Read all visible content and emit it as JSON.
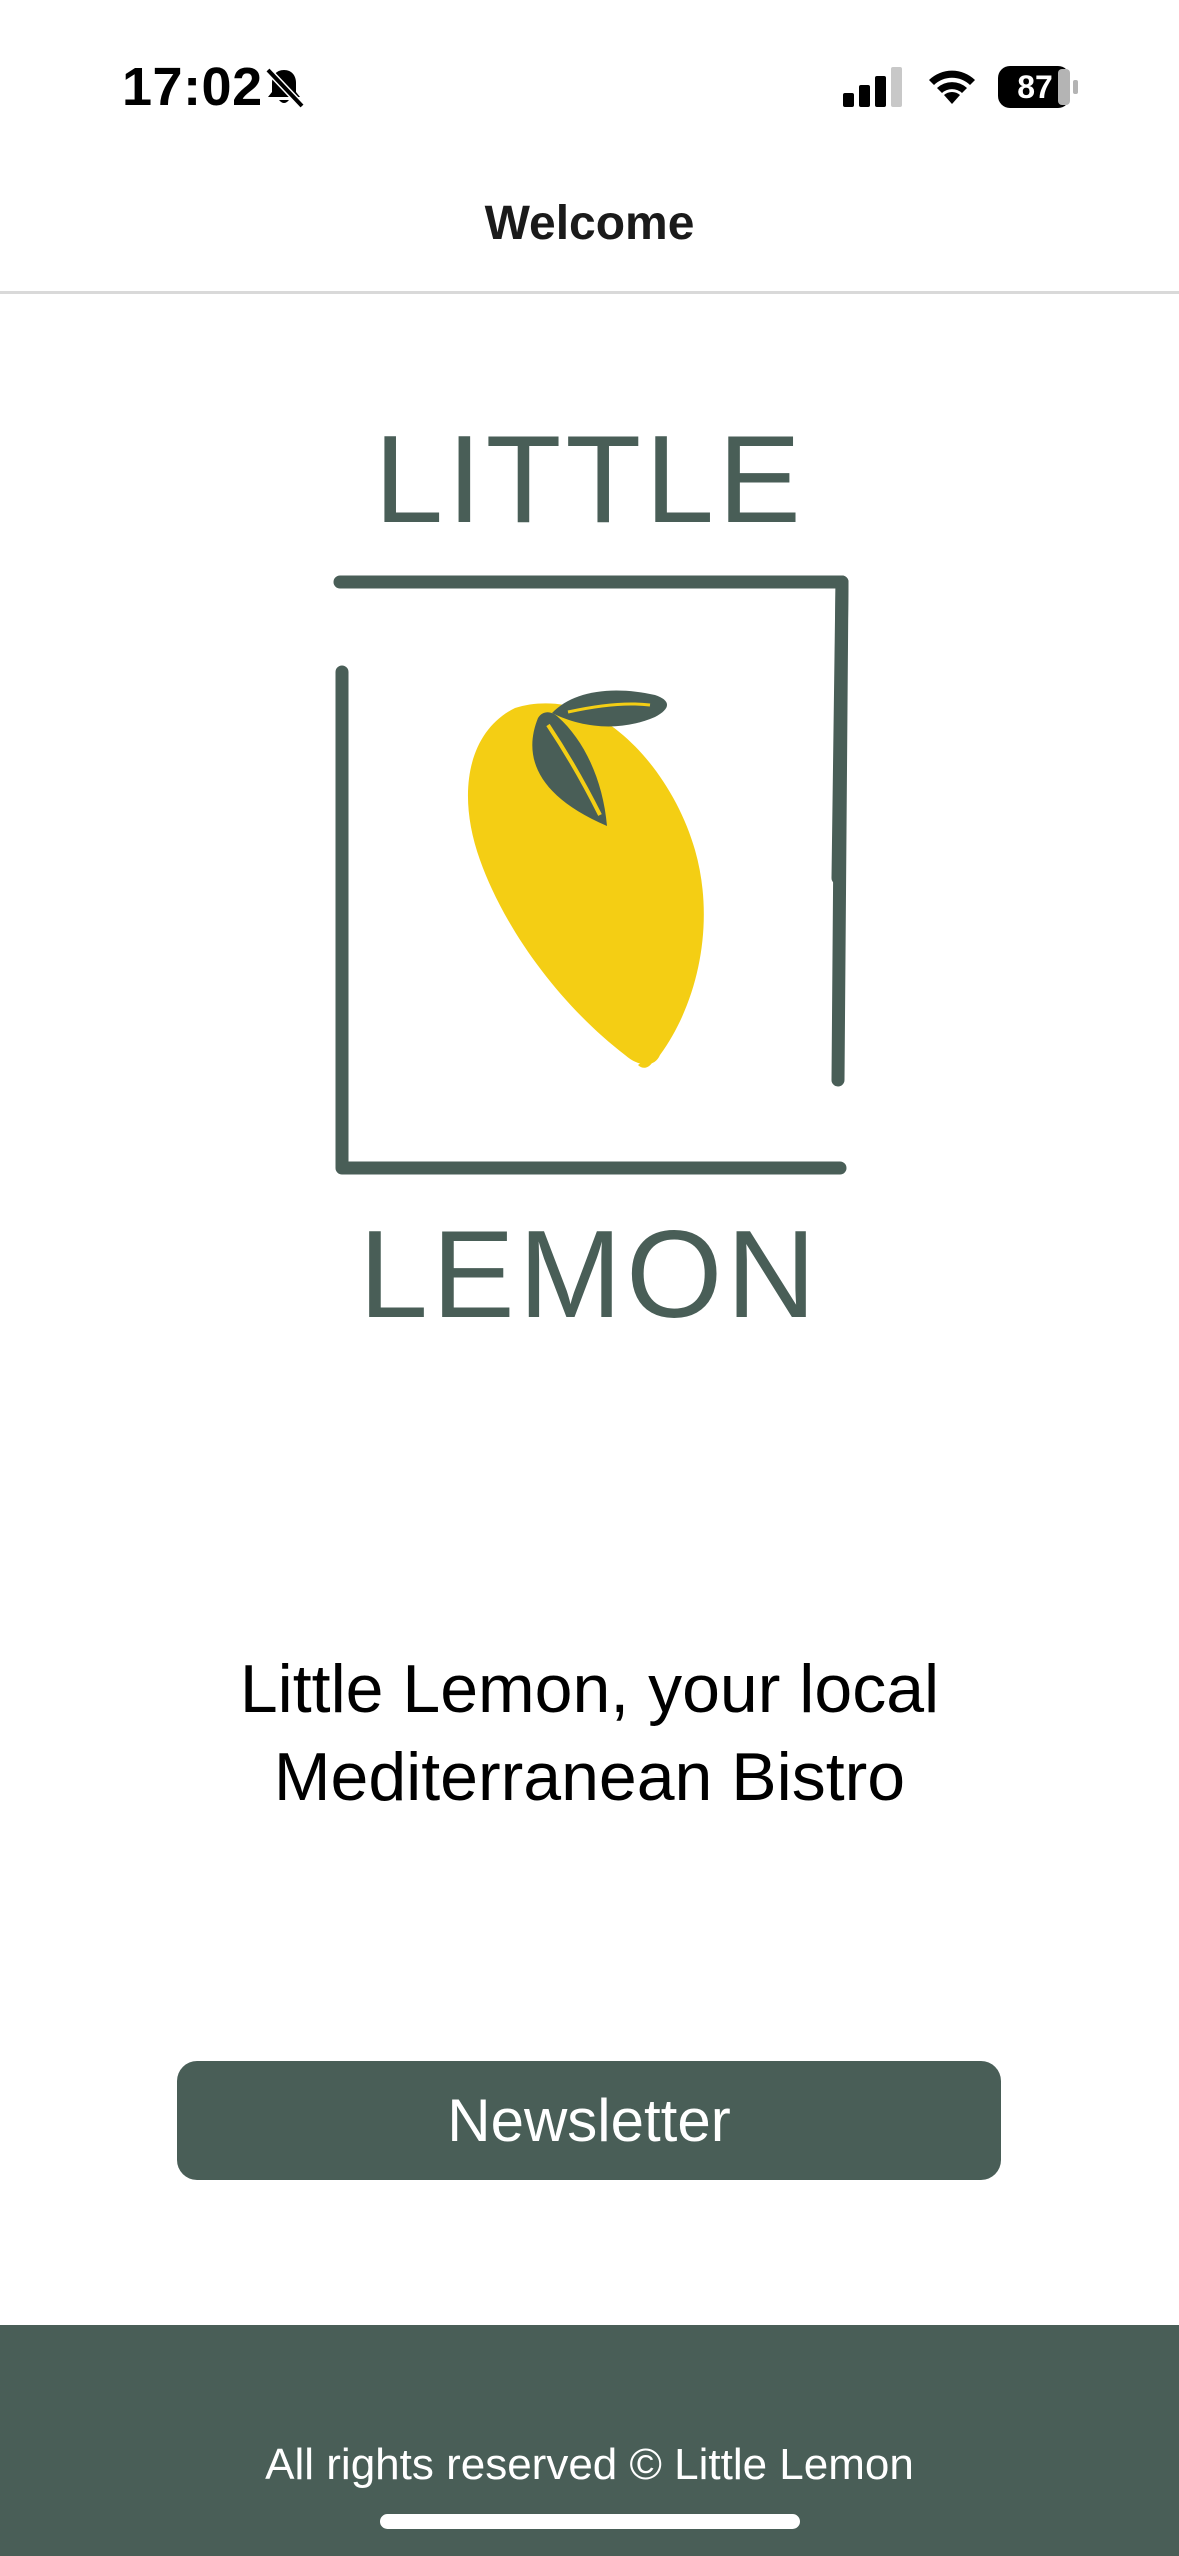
{
  "status_bar": {
    "time": "17:02",
    "battery": "87",
    "icons": [
      "bell-slash-icon",
      "cellular-signal-icon",
      "wifi-icon",
      "battery-icon"
    ]
  },
  "nav": {
    "title": "Welcome"
  },
  "logo": {
    "top_text": "LITTLE",
    "bottom_text": "LEMON",
    "colors": {
      "brand_green": "#495e57",
      "lemon_yellow": "#f4ce14"
    }
  },
  "tagline": {
    "line1": "Little Lemon, your local",
    "line2": "Mediterranean Bistro"
  },
  "newsletter_button": {
    "label": "Newsletter"
  },
  "footer": {
    "text": "All rights reserved © Little Lemon"
  }
}
